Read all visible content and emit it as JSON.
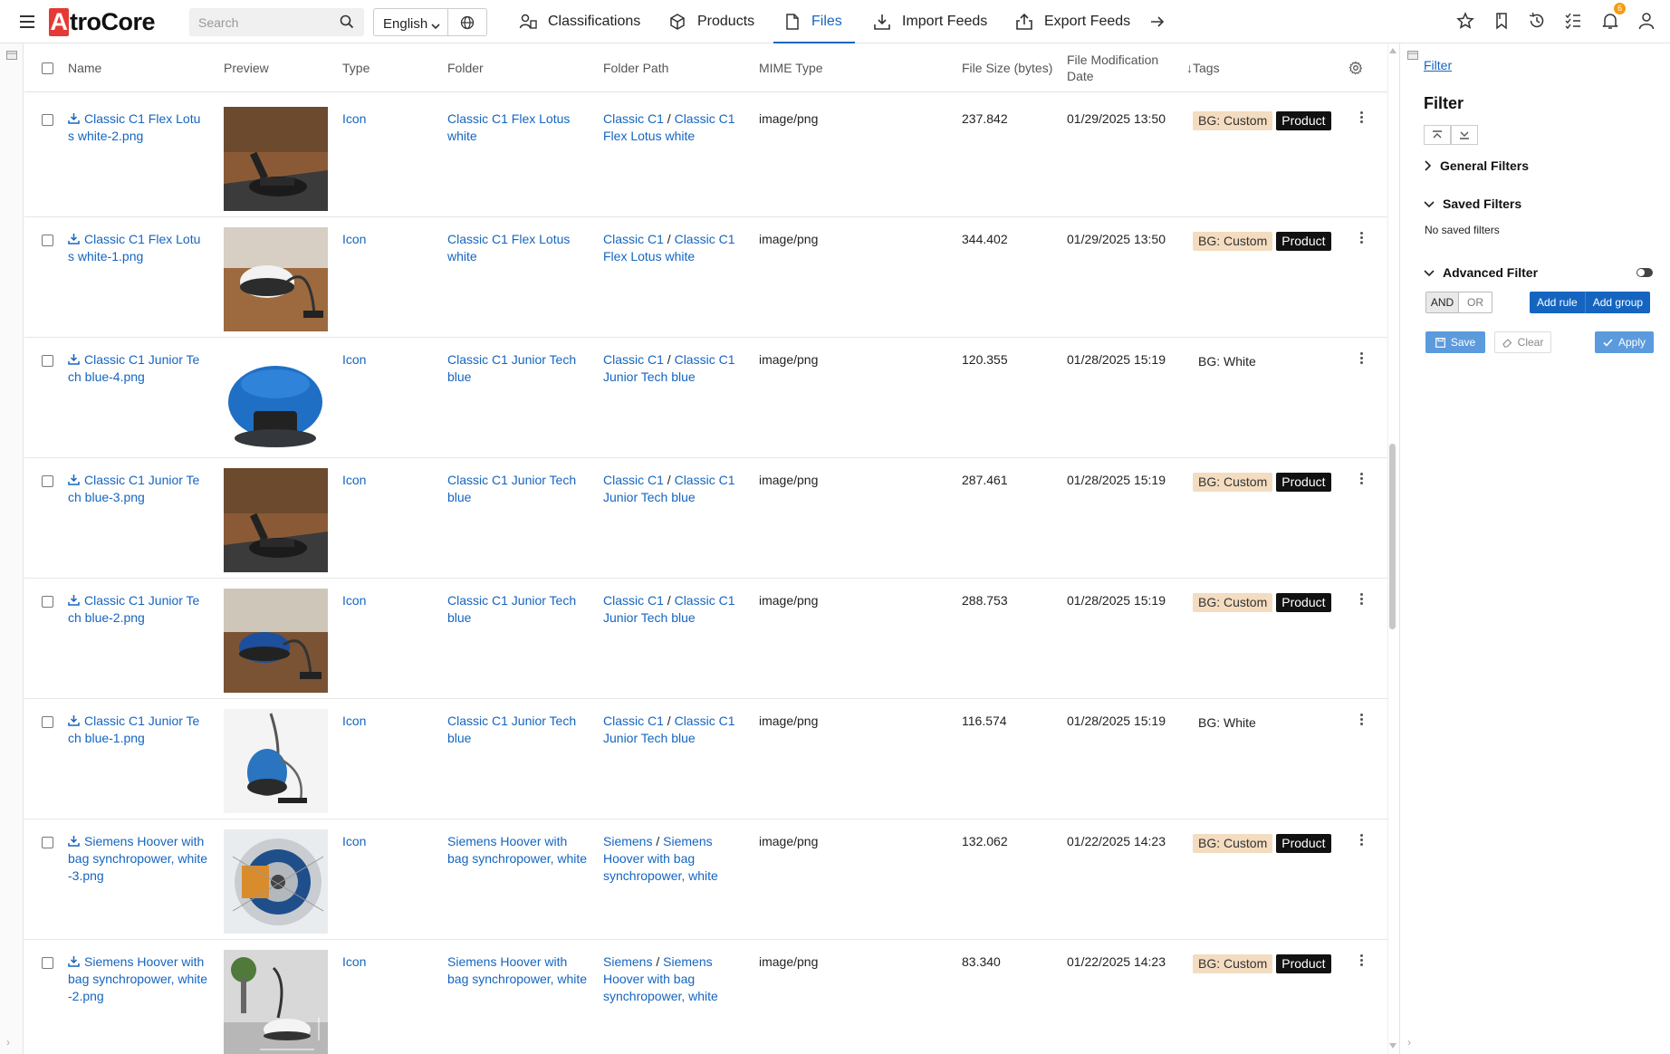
{
  "app": {
    "logo_letter": "A",
    "logo_rest": "troCore"
  },
  "search": {
    "placeholder": "Search",
    "value": ""
  },
  "language": {
    "selected": "English"
  },
  "nav": [
    {
      "label": "Classifications",
      "icon": "classifications-icon"
    },
    {
      "label": "Products",
      "icon": "products-cube-icon"
    },
    {
      "label": "Files",
      "icon": "file-icon",
      "active": true
    },
    {
      "label": "Import Feeds",
      "icon": "download-icon"
    },
    {
      "label": "Export Feeds",
      "icon": "upload-icon"
    }
  ],
  "notifications": {
    "count": "6"
  },
  "table": {
    "headers": {
      "name": "Name",
      "preview": "Preview",
      "type": "Type",
      "folder": "Folder",
      "folder_path": "Folder Path",
      "mime": "MIME Type",
      "size": "File Size (bytes)",
      "modified_line1": "File Modification",
      "modified_line2": "Date",
      "tags": "↓Tags"
    },
    "path_separator": "/",
    "rows": [
      {
        "name1": "Classic C1 Flex Lotu",
        "name2": "s white-2.png",
        "name3": "",
        "type": "Icon",
        "folder1": "Classic C1 Flex Lotus",
        "folder2": "white",
        "path1_a": "Classic C1",
        "path1_b": "Classic C1",
        "path2": "Flex Lotus white",
        "path3": "",
        "mime": "image/png",
        "size": "237.842",
        "date": "01/29/2025 13:50",
        "tag1": "BG: Custom",
        "tag2": "Product",
        "tag_style": "custom",
        "thumb": "vacuum-black-floor"
      },
      {
        "name1": "Classic C1 Flex Lotu",
        "name2": "s white-1.png",
        "name3": "",
        "type": "Icon",
        "folder1": "Classic C1 Flex Lotus",
        "folder2": "white",
        "path1_a": "Classic C1",
        "path1_b": "Classic C1",
        "path2": "Flex Lotus white",
        "path3": "",
        "mime": "image/png",
        "size": "344.402",
        "date": "01/29/2025 13:50",
        "tag1": "BG: Custom",
        "tag2": "Product",
        "tag_style": "custom",
        "thumb": "vacuum-white-floor"
      },
      {
        "name1": "Classic C1 Junior Te",
        "name2": "ch blue-4.png",
        "name3": "",
        "type": "Icon",
        "folder1": "Classic C1 Junior Tech",
        "folder2": "blue",
        "path1_a": "Classic C1",
        "path1_b": "Classic C1",
        "path2": "Junior Tech blue",
        "path3": "",
        "mime": "image/png",
        "size": "120.355",
        "date": "01/28/2025 15:19",
        "tag1": "BG: White",
        "tag2": "",
        "tag_style": "white",
        "thumb": "vacuum-blue-top"
      },
      {
        "name1": "Classic C1 Junior Te",
        "name2": "ch blue-3.png",
        "name3": "",
        "type": "Icon",
        "folder1": "Classic C1 Junior Tech",
        "folder2": "blue",
        "path1_a": "Classic C1",
        "path1_b": "Classic C1",
        "path2": "Junior Tech blue",
        "path3": "",
        "mime": "image/png",
        "size": "287.461",
        "date": "01/28/2025 15:19",
        "tag1": "BG: Custom",
        "tag2": "Product",
        "tag_style": "custom",
        "thumb": "vacuum-black-floor"
      },
      {
        "name1": "Classic C1 Junior Te",
        "name2": "ch blue-2.png",
        "name3": "",
        "type": "Icon",
        "folder1": "Classic C1 Junior Tech",
        "folder2": "blue",
        "path1_a": "Classic C1",
        "path1_b": "Classic C1",
        "path2": "Junior Tech blue",
        "path3": "",
        "mime": "image/png",
        "size": "288.753",
        "date": "01/28/2025 15:19",
        "tag1": "BG: Custom",
        "tag2": "Product",
        "tag_style": "custom",
        "thumb": "vacuum-blue-floor"
      },
      {
        "name1": "Classic C1 Junior Te",
        "name2": "ch blue-1.png",
        "name3": "",
        "type": "Icon",
        "folder1": "Classic C1 Junior Tech",
        "folder2": "blue",
        "path1_a": "Classic C1",
        "path1_b": "Classic C1",
        "path2": "Junior Tech blue",
        "path3": "",
        "mime": "image/png",
        "size": "116.574",
        "date": "01/28/2025 15:19",
        "tag1": "BG: White",
        "tag2": "",
        "tag_style": "white",
        "thumb": "vacuum-blue-white"
      },
      {
        "name1": "Siemens Hoover with",
        "name2": "bag synchropower, white",
        "name3": "-3.png",
        "type": "Icon",
        "folder1": "Siemens Hoover with",
        "folder2": "bag synchropower, white",
        "path1_a": "Siemens",
        "path1_b": "Siemens",
        "path2": "Hoover with bag",
        "path3": "synchropower, white",
        "mime": "image/png",
        "size": "132.062",
        "date": "01/22/2025 14:23",
        "tag1": "BG: Custom",
        "tag2": "Product",
        "tag_style": "custom",
        "thumb": "motor-cutaway"
      },
      {
        "name1": "Siemens Hoover with",
        "name2": "bag synchropower, white",
        "name3": "-2.png",
        "type": "Icon",
        "folder1": "Siemens Hoover with",
        "folder2": "bag synchropower, white",
        "path1_a": "Siemens",
        "path1_b": "Siemens",
        "path2": "Hoover with bag",
        "path3": "synchropower, white",
        "mime": "image/png",
        "size": "83.340",
        "date": "01/22/2025 14:23",
        "tag1": "BG: Custom",
        "tag2": "Product",
        "tag_style": "custom",
        "thumb": "vacuum-white-dimensions"
      }
    ]
  },
  "filter": {
    "link": "Filter",
    "title": "Filter",
    "general": "General Filters",
    "saved": "Saved Filters",
    "no_saved": "No saved filters",
    "advanced": "Advanced Filter",
    "and": "AND",
    "or": "OR",
    "add_rule": "Add rule",
    "add_group": "Add group",
    "save": "Save",
    "clear": "Clear",
    "apply": "Apply"
  },
  "colors": {
    "link": "#1565c0",
    "tag_custom": "#f3dcc0",
    "tag_product": "#111111",
    "badge": "#f39c12"
  }
}
